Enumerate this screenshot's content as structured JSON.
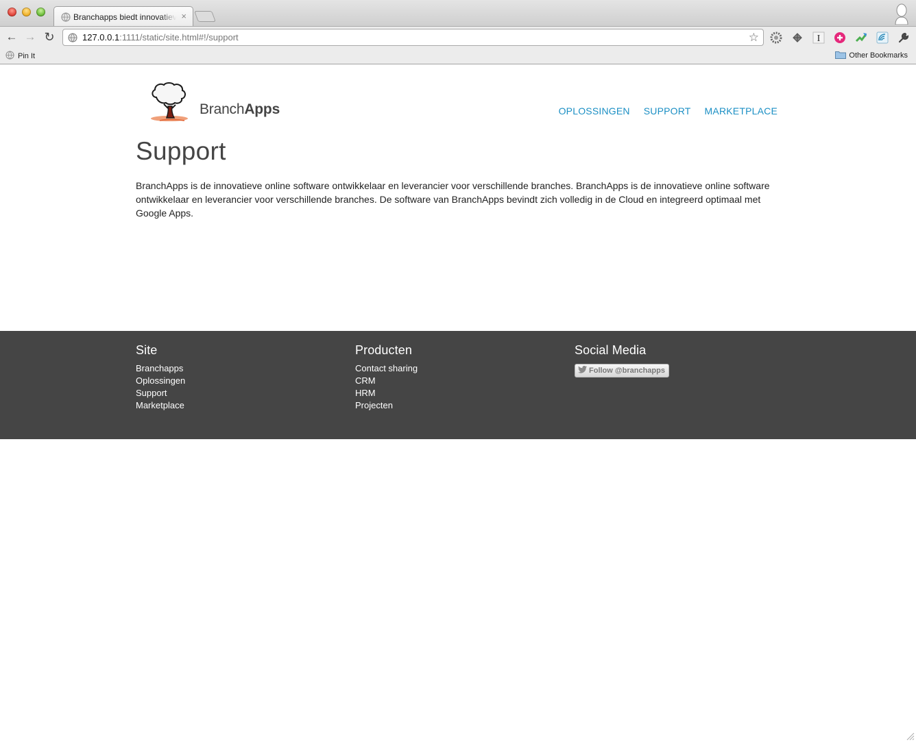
{
  "browser": {
    "tab_title": "Branchapps biedt innovatieve",
    "tab_close": "×",
    "url_host": "127.0.0.1",
    "url_rest": ":1111/static/site.html#!/support",
    "bookmark_pin": "Pin It",
    "bookmark_other": "Other Bookmarks",
    "extensions": [
      "gear-icon",
      "puzzle-icon",
      "instapaper-icon",
      "plus-icon",
      "arrows-icon",
      "wave-icon",
      "wrench-icon"
    ]
  },
  "header": {
    "logo_text_light": "Branch",
    "logo_text_bold": "Apps",
    "nav": [
      "OPLOSSINGEN",
      "SUPPORT",
      "MARKETPLACE"
    ]
  },
  "main": {
    "title": "Support",
    "body": "BranchApps is de innovatieve online software ontwikkelaar en leverancier voor verschillende branches. BranchApps is de innovatieve online software ontwikkelaar en leverancier voor verschillende branches. De software van BranchApps bevindt zich volledig in de Cloud en integreerd optimaal met Google Apps."
  },
  "footer": {
    "site": {
      "heading": "Site",
      "links": [
        "Branchapps",
        "Oplossingen",
        "Support",
        "Marketplace"
      ]
    },
    "products": {
      "heading": "Producten",
      "links": [
        "Contact sharing",
        "CRM",
        "HRM",
        "Projecten"
      ]
    },
    "social": {
      "heading": "Social Media",
      "follow_label": "Follow @branchapps"
    }
  },
  "colors": {
    "nav_link": "#1b8fc4",
    "footer_bg": "#454545",
    "title_text": "#444444"
  }
}
